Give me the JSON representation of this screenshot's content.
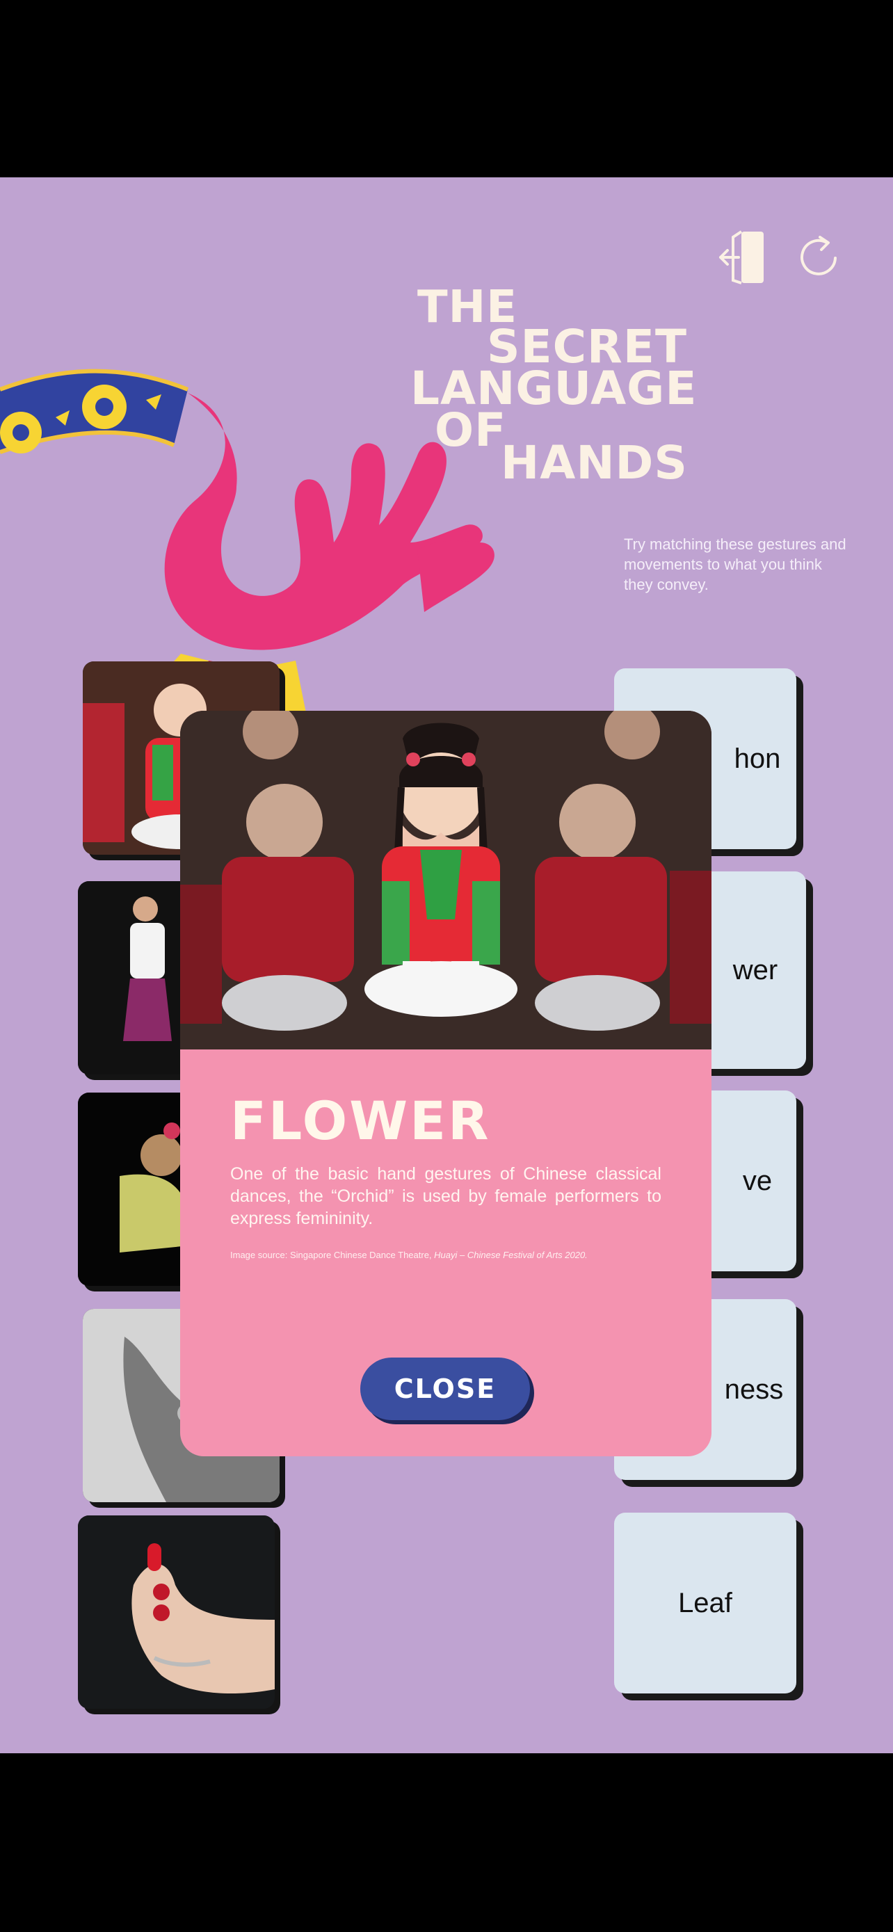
{
  "title": {
    "line1": "THE",
    "line2": "SECRET",
    "line3": "LANGUAGE",
    "line4": "OF",
    "line5": "HANDS"
  },
  "subtitle": "Try matching these gestures and movements to what you think they convey.",
  "icons": {
    "exit": "exit-door-icon",
    "refresh": "refresh-icon"
  },
  "answers": [
    {
      "label": "hon"
    },
    {
      "label": "wer"
    },
    {
      "label": "ve"
    },
    {
      "label": "ness"
    },
    {
      "label": "Leaf"
    }
  ],
  "modal": {
    "title": "FLOWER",
    "description": "One of the basic hand gestures of Chinese classical dances, the “Orchid” is used by female performers to express femininity.",
    "source_prefix": "Image source: Singapore Chinese Dance Theatre, ",
    "source_italic": "Huayi – Chinese Festival of Arts 2020.",
    "close_label": "CLOSE"
  },
  "colors": {
    "background": "#bfa3d1",
    "modal_pink": "#f493b0",
    "close_button": "#3a4ea0",
    "answer_card": "#dbe6ef",
    "title_text": "#fbf1e4"
  }
}
